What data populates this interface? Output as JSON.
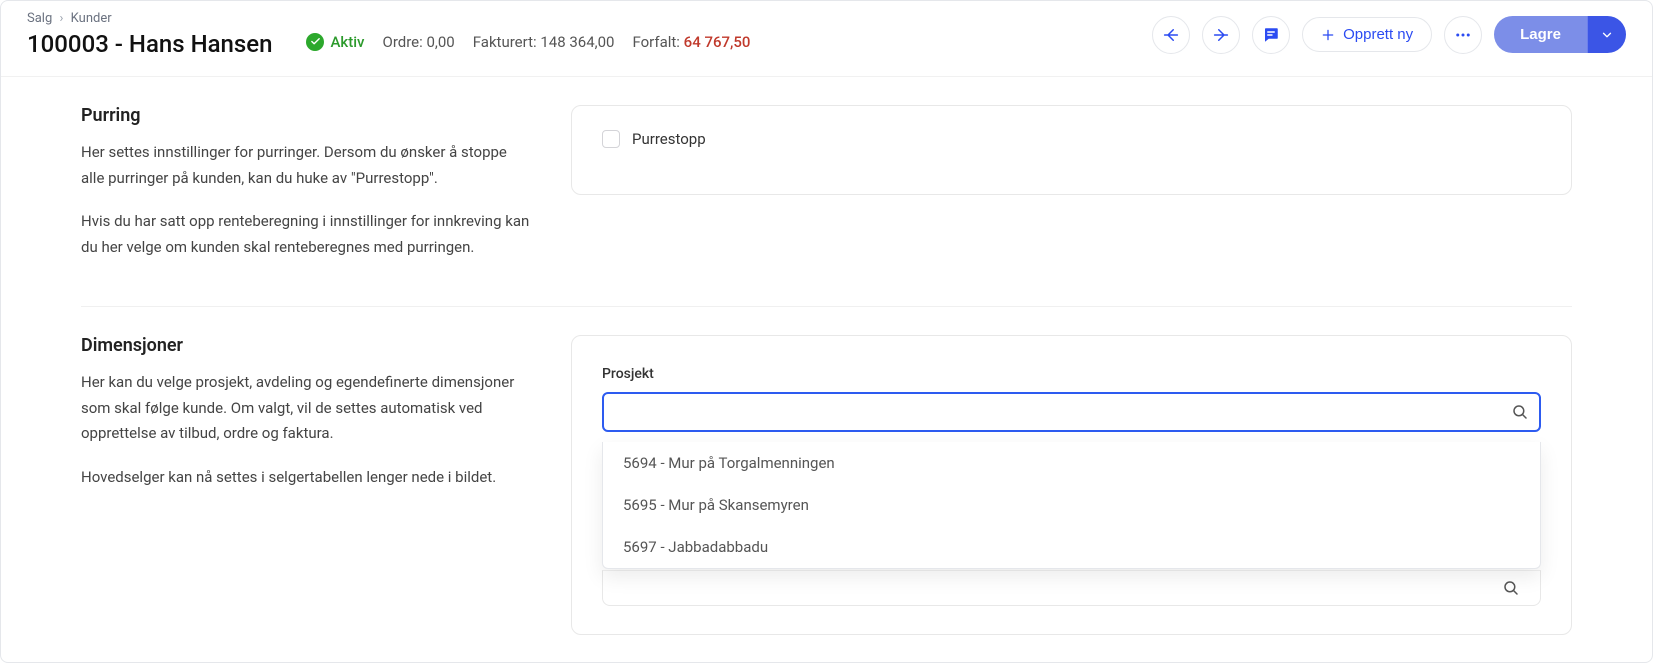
{
  "breadcrumb": {
    "parent": "Salg",
    "child": "Kunder"
  },
  "title": "100003 - Hans Hansen",
  "status": {
    "label": "Aktiv"
  },
  "meta": {
    "ordre_label": "Ordre:",
    "ordre_value": "0,00",
    "fakturert_label": "Fakturert:",
    "fakturert_value": "148 364,00",
    "forfalt_label": "Forfalt:",
    "forfalt_value": "64 767,50"
  },
  "actions": {
    "opprett_ny": "Opprett ny",
    "lagre": "Lagre"
  },
  "sections": {
    "purring": {
      "title": "Purring",
      "desc1": "Her settes innstillinger for purringer. Dersom du ønsker å stoppe alle purringer på kunden, kan du huke av \"Purrestopp\".",
      "desc2": "Hvis du har satt opp renteberegning i innstillinger for innkreving kan du her velge om kunden skal renteberegnes med purringen.",
      "checkbox_label": "Purrestopp"
    },
    "dimensjoner": {
      "title": "Dimensjoner",
      "desc1": "Her kan du velge prosjekt, avdeling og egendefinerte dimensjoner som skal følge kunde. Om valgt, vil de settes automatisk ved opprettelse av tilbud, ordre og faktura.",
      "desc2": "Hovedselger kan nå settes i selgertabellen lenger nede i bildet.",
      "prosjekt_label": "Prosjekt",
      "options": [
        "5694 - Mur på Torgalmenningen",
        "5695 - Mur på Skansemyren",
        "5697 - Jabbadabbadu"
      ]
    }
  }
}
